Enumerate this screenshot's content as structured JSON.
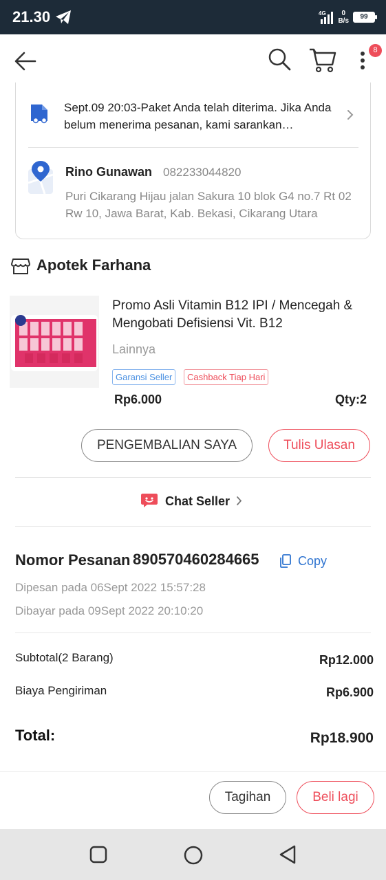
{
  "status_bar": {
    "time": "21.30",
    "network_type": "4G",
    "net_speed_value": "0",
    "net_speed_unit": "B/s",
    "battery_level": "99",
    "notification_icon": "telegram-icon"
  },
  "header": {
    "back_icon": "arrow-left-icon",
    "search_icon": "search-icon",
    "cart_icon": "cart-icon",
    "more_icon": "more-vertical-icon",
    "notification_count": "8"
  },
  "delivery": {
    "tracking_status": "Sept.09 20:03-Paket Anda telah diterima. Jika Anda belum menerima pesanan, kami sarankan…",
    "recipient_name": "Rino Gunawan",
    "recipient_phone": "082233044820",
    "recipient_address": "Puri Cikarang Hijau jalan Sakura 10 blok G4 no.7 Rt 02 Rw 10, Jawa Barat, Kab. Bekasi, Cikarang Utara"
  },
  "store": {
    "name": "Apotek Farhana"
  },
  "product": {
    "title": "Promo Asli Vitamin B12 IPI / Mencegah & Mengobati Defisiensi Vit. B12",
    "variant": "Lainnya",
    "tags": [
      "Garansi Seller",
      "Cashback Tiap Hari"
    ],
    "price": "Rp6.000",
    "quantity": "Qty:2"
  },
  "actions": {
    "return_label": "PENGEMBALIAN SAYA",
    "review_label": "Tulis Ulasan",
    "chat_label": "Chat Seller"
  },
  "order": {
    "number_label": "Nomor Pesanan",
    "number": "890570460284665",
    "copy_label": "Copy",
    "ordered_at": "Dipesan pada 06Sept 2022 15:57:28",
    "paid_at": "Dibayar pada 09Sept 2022 20:10:20"
  },
  "summary": {
    "subtotal_label": "Subtotal(2 Barang)",
    "subtotal_value": "Rp12.000",
    "shipping_label": "Biaya Pengiriman",
    "shipping_value": "Rp6.900",
    "total_label": "Total:",
    "total_value": "Rp18.900"
  },
  "footer": {
    "invoice_label": "Tagihan",
    "buy_again_label": "Beli lagi"
  },
  "colors": {
    "accent": "#ee4d5a",
    "link": "#2f74d0",
    "status_bar": "#1d2b38"
  }
}
